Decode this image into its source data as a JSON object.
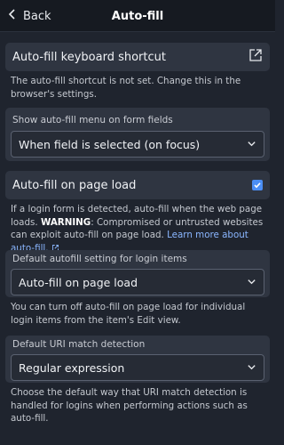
{
  "header": {
    "back_label": "Back",
    "title": "Auto-fill"
  },
  "shortcut": {
    "label": "Auto-fill keyboard shortcut",
    "icon": "external-link-icon",
    "help": "The auto-fill shortcut is not set. Change this in the browser's settings."
  },
  "show_menu": {
    "label": "Show auto-fill menu on form fields",
    "selected": "When field is selected (on focus)"
  },
  "page_load": {
    "label": "Auto-fill on page load",
    "checked": true,
    "help_text": "If a login form is detected, auto-fill when the web page loads.",
    "warning_label": "WARNING",
    "warning_text": ": Compromised or untrusted websites can exploit auto-fill on page load.",
    "learn_more": "Learn more about auto-fill."
  },
  "default_login": {
    "label": "Default autofill setting for login items",
    "selected": "Auto-fill on page load",
    "help": "You can turn off auto-fill on page load for individual login items from the item's Edit view."
  },
  "uri_match": {
    "label": "Default URI match detection",
    "selected": "Regular expression",
    "help": "Choose the default way that URI match detection is handled for logins when performing actions such as auto-fill."
  },
  "colors": {
    "background": "#1f242e",
    "card": "#2f3541",
    "accent": "#4b8ef5",
    "link": "#8ab6ff"
  }
}
